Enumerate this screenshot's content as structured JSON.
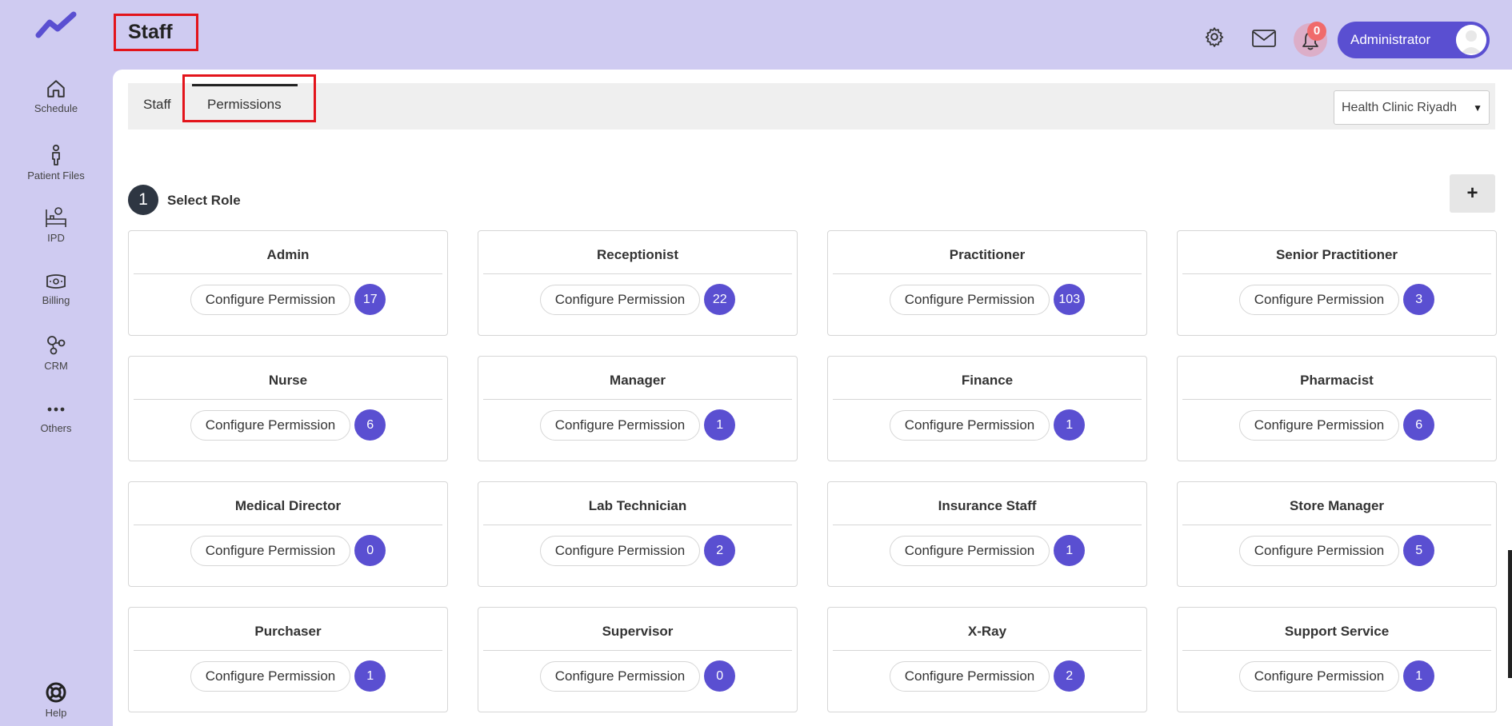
{
  "sidebar": {
    "items": [
      {
        "label": "Schedule",
        "icon": "home-icon"
      },
      {
        "label": "Patient Files",
        "icon": "person-icon"
      },
      {
        "label": "IPD",
        "icon": "bed-icon"
      },
      {
        "label": "Billing",
        "icon": "money-icon"
      },
      {
        "label": "CRM",
        "icon": "crm-icon"
      },
      {
        "label": "Others",
        "icon": "dots-icon"
      }
    ],
    "help_label": "Help"
  },
  "header": {
    "title": "Staff",
    "notifications_count": "0",
    "user_name": "Administrator"
  },
  "tabs": [
    {
      "label": "Staff"
    },
    {
      "label": "Permissions"
    }
  ],
  "clinic_select": {
    "value": "Health Clinic Riyadh"
  },
  "step": {
    "number": "1",
    "label": "Select Role",
    "add_label": "+"
  },
  "roles": [
    {
      "name": "Admin",
      "button": "Configure Permission",
      "count": "17"
    },
    {
      "name": "Receptionist",
      "button": "Configure Permission",
      "count": "22"
    },
    {
      "name": "Practitioner",
      "button": "Configure Permission",
      "count": "103"
    },
    {
      "name": "Senior Practitioner",
      "button": "Configure Permission",
      "count": "3"
    },
    {
      "name": "Nurse",
      "button": "Configure Permission",
      "count": "6"
    },
    {
      "name": "Manager",
      "button": "Configure Permission",
      "count": "1"
    },
    {
      "name": "Finance",
      "button": "Configure Permission",
      "count": "1"
    },
    {
      "name": "Pharmacist",
      "button": "Configure Permission",
      "count": "6"
    },
    {
      "name": "Medical Director",
      "button": "Configure Permission",
      "count": "0"
    },
    {
      "name": "Lab Technician",
      "button": "Configure Permission",
      "count": "2"
    },
    {
      "name": "Insurance Staff",
      "button": "Configure Permission",
      "count": "1"
    },
    {
      "name": "Store Manager",
      "button": "Configure Permission",
      "count": "5"
    },
    {
      "name": "Purchaser",
      "button": "Configure Permission",
      "count": "1"
    },
    {
      "name": "Supervisor",
      "button": "Configure Permission",
      "count": "0"
    },
    {
      "name": "X-Ray",
      "button": "Configure Permission",
      "count": "2"
    },
    {
      "name": "Support Service",
      "button": "Configure Permission",
      "count": "1"
    }
  ],
  "colors": {
    "accent": "#5a4fd1",
    "background": "#cfcbf1",
    "highlight_border": "#e3141b"
  }
}
